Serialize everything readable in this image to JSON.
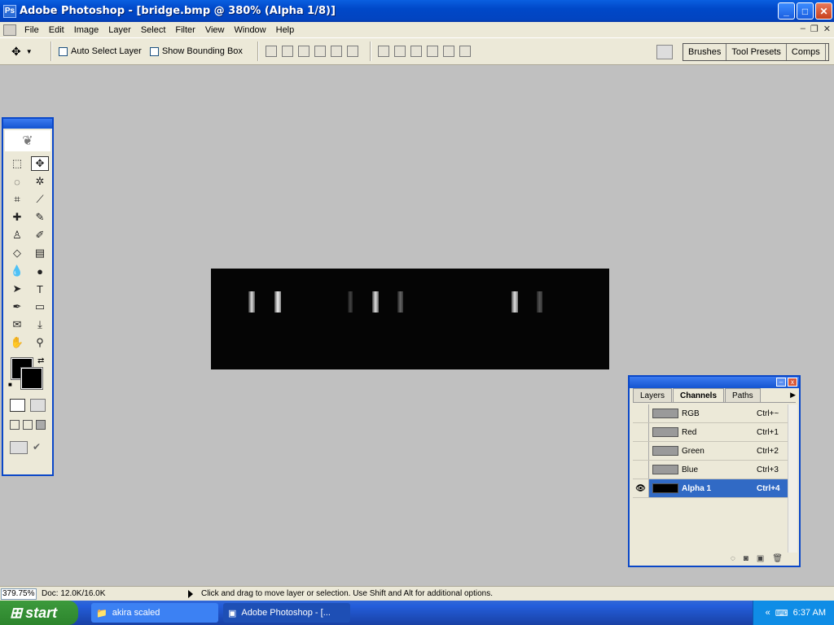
{
  "window": {
    "title": "Adobe Photoshop - [bridge.bmp @ 380% (Alpha 1/8)]",
    "minimize": "_",
    "maximize": "□",
    "close": "✕"
  },
  "menu": [
    "File",
    "Edit",
    "Image",
    "Layer",
    "Select",
    "Filter",
    "View",
    "Window",
    "Help"
  ],
  "options": {
    "auto_select": "Auto Select Layer",
    "show_bbox": "Show Bounding Box"
  },
  "palette_well": [
    "Brushes",
    "Tool Presets",
    "Comps"
  ],
  "status": {
    "zoom": "379.75%",
    "doc": "Doc: 12.0K/16.0K",
    "hint": "Click and drag to move layer or selection.  Use Shift and Alt for additional options."
  },
  "panel": {
    "tabs": [
      "Layers",
      "Channels",
      "Paths"
    ],
    "channels": [
      {
        "name": "RGB",
        "shortcut": "Ctrl+~"
      },
      {
        "name": "Red",
        "shortcut": "Ctrl+1"
      },
      {
        "name": "Green",
        "shortcut": "Ctrl+2"
      },
      {
        "name": "Blue",
        "shortcut": "Ctrl+3"
      },
      {
        "name": "Alpha 1",
        "shortcut": "Ctrl+4"
      }
    ]
  },
  "taskbar": {
    "start": "start",
    "tasks": [
      "akira scaled",
      "Adobe Photoshop - [..."
    ],
    "time": "6:37 AM"
  },
  "colors": {
    "titlebar": "#0a5fe0",
    "selection": "#316ac5"
  }
}
